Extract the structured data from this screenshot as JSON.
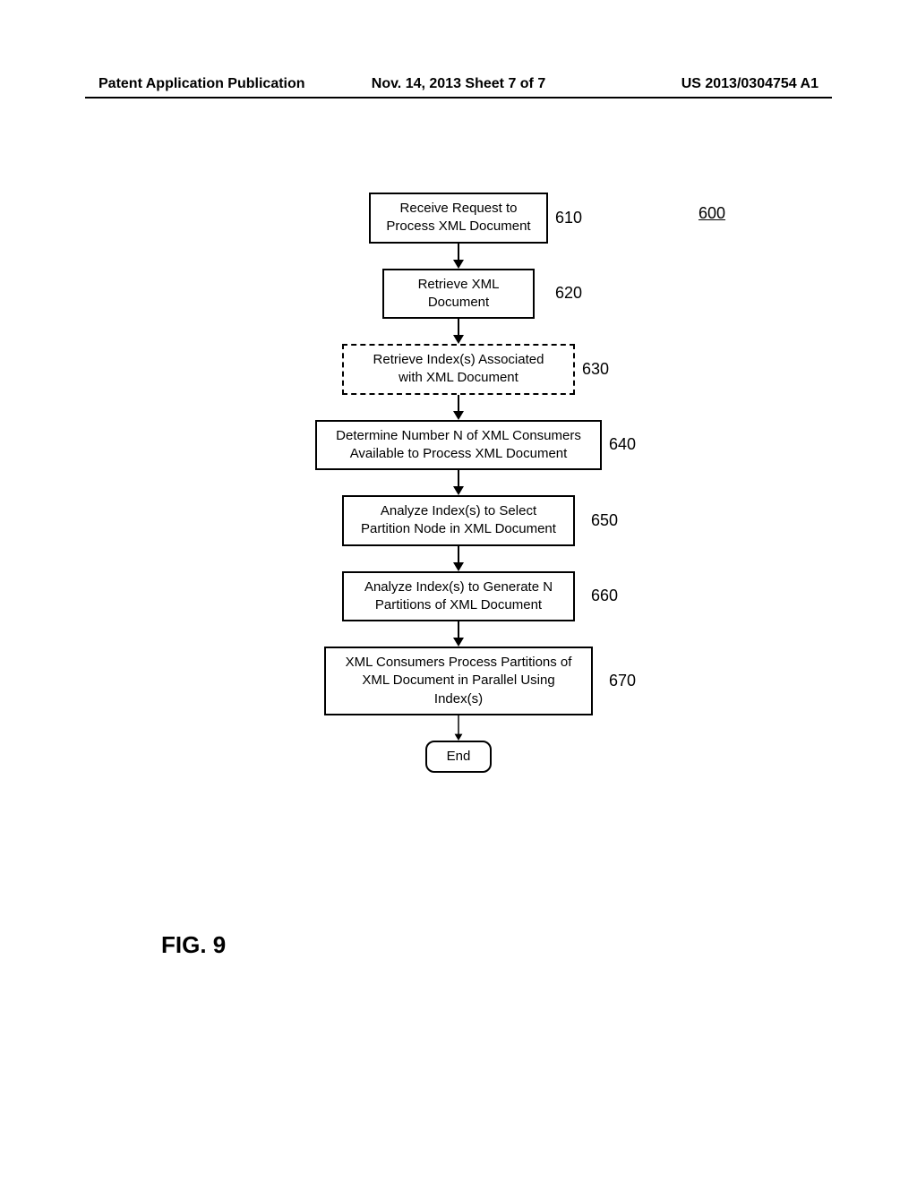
{
  "header": {
    "left": "Patent Application Publication",
    "center": "Nov. 14, 2013  Sheet 7 of 7",
    "right": "US 2013/0304754 A1"
  },
  "figure_number": "600",
  "figure_label": "FIG. 9",
  "chart_data": {
    "type": "flowchart",
    "orientation": "vertical",
    "nodes": [
      {
        "id": "610",
        "text": "Receive Request to\nProcess XML Document",
        "ref": "610",
        "style": "solid"
      },
      {
        "id": "620",
        "text": "Retrieve XML\nDocument",
        "ref": "620",
        "style": "solid"
      },
      {
        "id": "630",
        "text": "Retrieve Index(s) Associated\nwith XML Document",
        "ref": "630",
        "style": "dashed"
      },
      {
        "id": "640",
        "text": "Determine Number N of XML Consumers\nAvailable to Process XML Document",
        "ref": "640",
        "style": "solid"
      },
      {
        "id": "650",
        "text": "Analyze Index(s) to Select\nPartition Node in XML Document",
        "ref": "650",
        "style": "solid"
      },
      {
        "id": "660",
        "text": "Analyze Index(s) to Generate N\nPartitions of XML Document",
        "ref": "660",
        "style": "solid"
      },
      {
        "id": "670",
        "text": "XML Consumers Process Partitions of\nXML Document in Parallel Using\nIndex(s)",
        "ref": "670",
        "style": "solid"
      },
      {
        "id": "end",
        "text": "End",
        "ref": "",
        "style": "rounded"
      }
    ],
    "edges": [
      {
        "from": "610",
        "to": "620"
      },
      {
        "from": "620",
        "to": "630"
      },
      {
        "from": "630",
        "to": "640"
      },
      {
        "from": "640",
        "to": "650"
      },
      {
        "from": "650",
        "to": "660"
      },
      {
        "from": "660",
        "to": "670"
      },
      {
        "from": "670",
        "to": "end"
      }
    ]
  }
}
